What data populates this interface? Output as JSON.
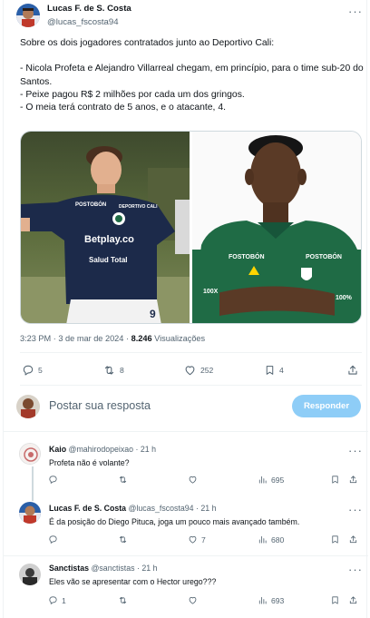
{
  "main_tweet": {
    "author_name": "Lucas F. de S. Costa",
    "author_handle": "@lucas_fscosta94",
    "text": "Sobre os dois jogadores contratados junto ao Deportivo Cali:\n\n- Nicola Profeta e Alejandro Villarreal chegam, em princípio, para o time sub-20 do Santos.\n- Peixe pagou R$ 2 milhões por cada um dos gringos.\n- O meia terá contrato de 5 anos, e o atacante, 4.",
    "time": "3:23 PM · 3 de mar de 2024 · ",
    "views_count": "8.246",
    "views_label": " Visualizações",
    "replies": "5",
    "reposts": "8",
    "likes": "252",
    "bookmarks": "4",
    "jersey_left": {
      "sponsor1": "POSTOBÓN",
      "sponsor2": "DEPORTIVO CALI",
      "sponsor3": "Betplay.co",
      "sponsor4": "Salud Total",
      "number": "9"
    },
    "jersey_right": {
      "sponsor1": "FOSTOBÓN",
      "sponsor2": "POSTOBÓN",
      "sponsor3": "100X",
      "sponsor4": "100%"
    }
  },
  "composer": {
    "placeholder": "Postar sua resposta",
    "reply_button": "Responder"
  },
  "replies": [
    {
      "name": "Kaio",
      "handle": "@mahirodopeixao",
      "time": "· 21 h",
      "text": "Profeta não é volante?",
      "replies": "",
      "reposts": "",
      "likes": "",
      "views": "695"
    },
    {
      "name": "Lucas F. de S. Costa",
      "handle": "@lucas_fscosta94",
      "time": "· 21 h",
      "text": "É da posição do Diego Pituca, joga um pouco mais avançado também.",
      "replies": "",
      "reposts": "",
      "likes": "7",
      "views": "680"
    },
    {
      "name": "Sanctistas",
      "handle": "@sanctistas",
      "time": "· 21 h",
      "text": "Eles vão se apresentar com o Hector urego???",
      "replies": "1",
      "reposts": "",
      "likes": "",
      "views": "693"
    }
  ],
  "colors": {
    "accent": "#1d9bf0",
    "reply_button_disabled": "#8ecdf7",
    "muted_text": "#536471",
    "text": "#0f1419",
    "jersey_dark_blue": "#1c2a4a",
    "jersey_green": "#1f6b45"
  }
}
